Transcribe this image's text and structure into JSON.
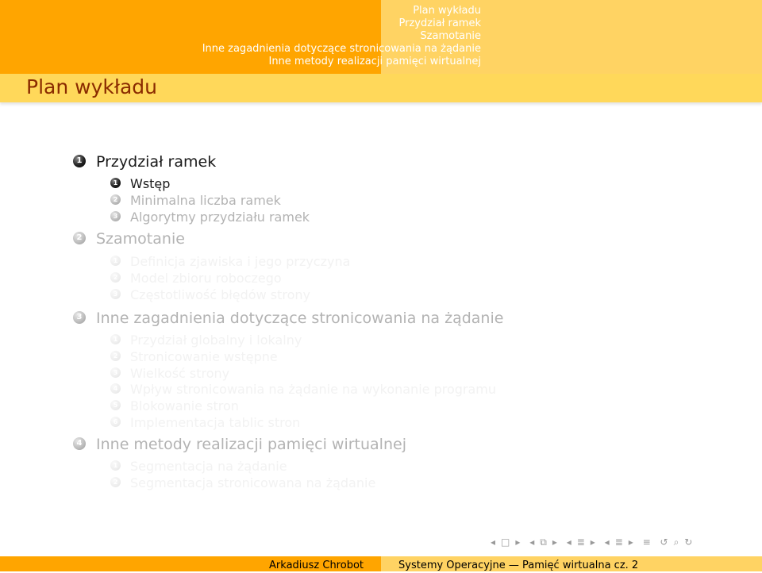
{
  "header": {
    "nav_lines": [
      "Plan wykładu",
      "Przydział ramek",
      "Szamotanie",
      "Inne zagadnienia dotyczące stronicowania na żądanie",
      "Inne metody realizacji pamięci wirtualnej"
    ]
  },
  "frame_title": "Plan wykładu",
  "outline": {
    "sections": [
      {
        "number": "1",
        "label": "Przydział ramek",
        "state": "current",
        "subsections": [
          {
            "number": "1",
            "label": "Wstęp",
            "state": "current"
          },
          {
            "number": "2",
            "label": "Minimalna liczba ramek",
            "state": "faded"
          },
          {
            "number": "3",
            "label": "Algorytmy przydziału ramek",
            "state": "faded"
          }
        ]
      },
      {
        "number": "2",
        "label": "Szamotanie",
        "state": "faded",
        "subsections": [
          {
            "number": "1",
            "label": "Definicja zjawiska i jego przyczyna",
            "state": "hidden"
          },
          {
            "number": "2",
            "label": "Model zbioru roboczego",
            "state": "hidden"
          },
          {
            "number": "3",
            "label": "Częstotliwość błędów strony",
            "state": "hidden"
          }
        ]
      },
      {
        "number": "3",
        "label": "Inne zagadnienia dotyczące stronicowania na żądanie",
        "state": "faded",
        "subsections": [
          {
            "number": "1",
            "label": "Przydział globalny i lokalny",
            "state": "hidden"
          },
          {
            "number": "2",
            "label": "Stronicowanie wstępne",
            "state": "hidden"
          },
          {
            "number": "3",
            "label": "Wielkość strony",
            "state": "hidden"
          },
          {
            "number": "4",
            "label": "Wpływ stronicowania na żądanie na wykonanie programu",
            "state": "hidden"
          },
          {
            "number": "5",
            "label": "Blokowanie stron",
            "state": "hidden"
          },
          {
            "number": "6",
            "label": "Implementacja tablic stron",
            "state": "hidden"
          }
        ]
      },
      {
        "number": "4",
        "label": "Inne metody realizacji pamięci wirtualnej",
        "state": "faded",
        "subsections": [
          {
            "number": "1",
            "label": "Segmentacja na żądanie",
            "state": "hidden"
          },
          {
            "number": "2",
            "label": "Segmentacja stronicowana na żądanie",
            "state": "hidden"
          }
        ]
      }
    ]
  },
  "nav_controls": {
    "icons": [
      "arrow-left-icon",
      "frame-icon",
      "arrow-right-icon",
      "arrow-left-icon",
      "subsection-icon",
      "arrow-right-icon",
      "arrow-left-icon",
      "section-icon",
      "arrow-right-icon",
      "arrow-left-icon",
      "section-icon",
      "arrow-right-icon",
      "align-icon",
      "search-back-icon",
      "search-icon"
    ]
  },
  "footer": {
    "author": "Arkadiusz Chrobot",
    "title": "Systemy Operacyjne — Pamięć wirtualna cz. 2"
  },
  "colors": {
    "header_dark": "#ffa500",
    "header_light": "#ffd363",
    "title_color": "#8a2b00"
  }
}
